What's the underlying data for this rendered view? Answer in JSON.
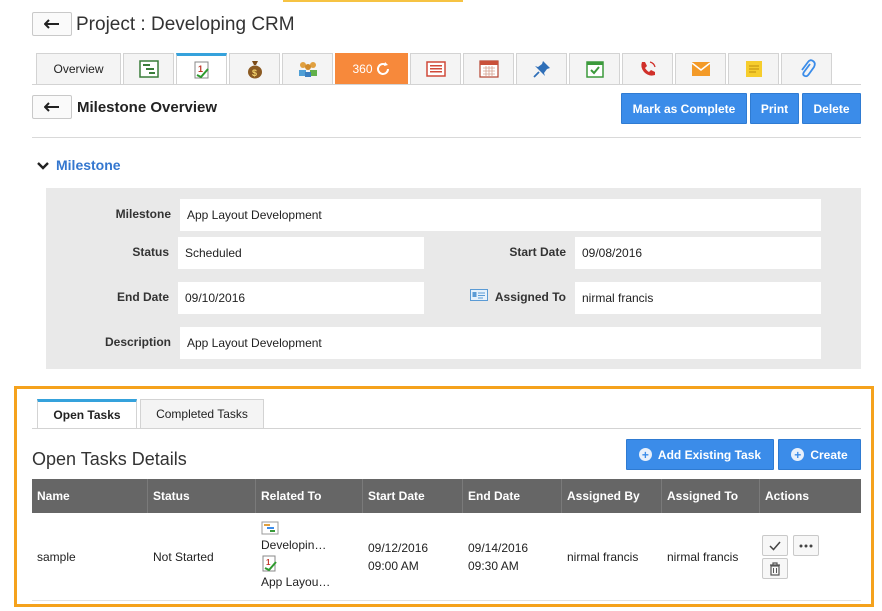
{
  "project": {
    "title": "Project : Developing CRM"
  },
  "module_tabs": [
    {
      "label": "Overview"
    },
    {
      "icon": "gantt-icon"
    },
    {
      "icon": "milestone-icon"
    },
    {
      "icon": "money-bag-icon"
    },
    {
      "icon": "people-icon"
    },
    {
      "label": "360",
      "icon": "refresh-icon"
    },
    {
      "icon": "invoice-icon"
    },
    {
      "icon": "calendar-icon"
    },
    {
      "icon": "pin-icon"
    },
    {
      "icon": "checkbox-calendar-icon"
    },
    {
      "icon": "phone-icon"
    },
    {
      "icon": "envelope-icon"
    },
    {
      "icon": "sticky-note-icon"
    },
    {
      "icon": "paperclip-icon"
    }
  ],
  "overview": {
    "title": "Milestone Overview",
    "buttons": {
      "complete": "Mark as Complete",
      "print": "Print",
      "delete": "Delete"
    }
  },
  "section": {
    "title": "Milestone"
  },
  "details": {
    "milestone_label": "Milestone",
    "milestone_value": "App Layout Development",
    "status_label": "Status",
    "status_value": "Scheduled",
    "start_label": "Start Date",
    "start_value": "09/08/2016",
    "end_label": "End Date",
    "end_value": "09/10/2016",
    "assigned_label": "Assigned To",
    "assigned_value": "nirmal francis",
    "description_label": "Description",
    "description_value": "App Layout Development"
  },
  "task_tabs": {
    "open": "Open Tasks",
    "completed": "Completed Tasks"
  },
  "tasks": {
    "title": "Open Tasks Details",
    "add_existing": "Add Existing Task",
    "create": "Create",
    "columns": [
      "Name",
      "Status",
      "Related To",
      "Start Date",
      "End Date",
      "Assigned By",
      "Assigned To",
      "Actions"
    ],
    "rows": [
      {
        "name": "sample",
        "status": "Not Started",
        "related_1": "Developin…",
        "related_2": "App Layou…",
        "start_date": "09/12/2016",
        "start_time": "09:00 AM",
        "end_date": "09/14/2016",
        "end_time": "09:30 AM",
        "assigned_by": "nirmal francis",
        "assigned_to": "nirmal francis"
      }
    ]
  },
  "colors": {
    "accent_blue": "#3b8ce9",
    "highlight_orange": "#f5a21c",
    "tab_active": "#35a2dc",
    "header_gray": "#666666"
  }
}
